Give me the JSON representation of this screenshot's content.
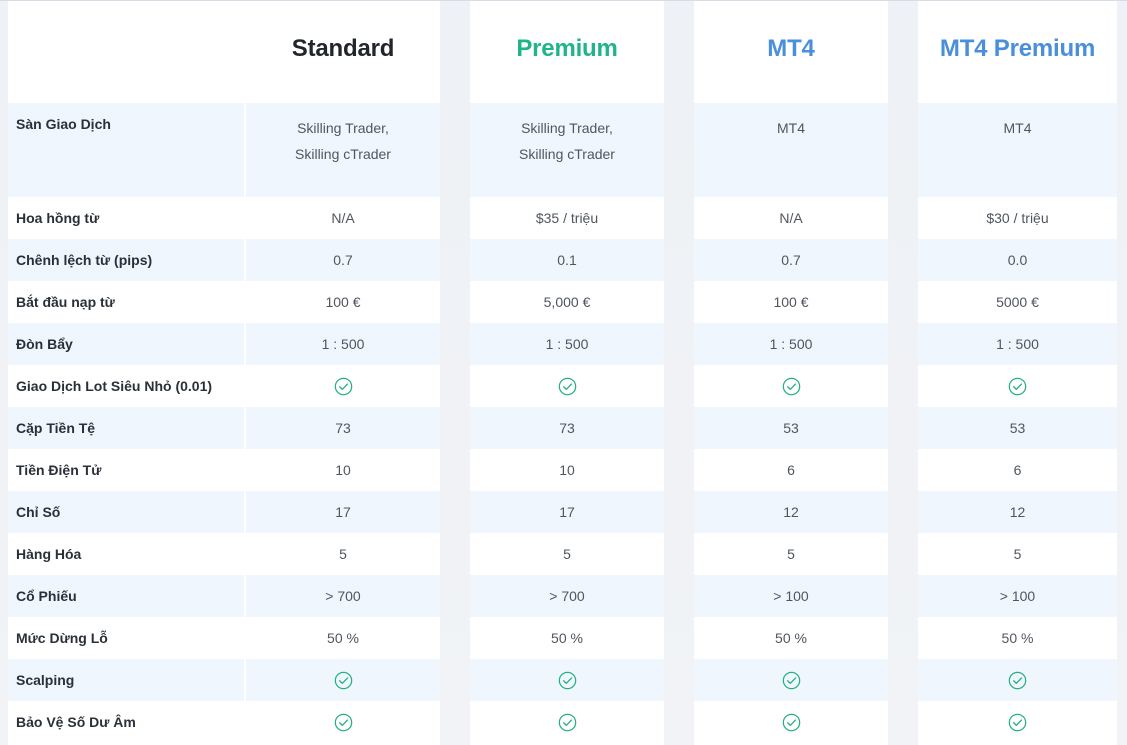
{
  "columns": [
    {
      "name": "Standard",
      "color": "#22262c"
    },
    {
      "name": "Premium",
      "color": "#1fb48c"
    },
    {
      "name": "MT4",
      "color": "#4a8fdc"
    },
    {
      "name": "MT4 Premium",
      "color": "#4a8fdc"
    }
  ],
  "check_color": "#27b07f",
  "rows": [
    {
      "label": "Sàn Giao Dịch",
      "values": [
        [
          "Skilling Trader,",
          "Skilling cTrader"
        ],
        [
          "Skilling Trader,",
          "Skilling cTrader"
        ],
        [
          "MT4"
        ],
        [
          "MT4"
        ]
      ]
    },
    {
      "label": "Hoa hồng từ",
      "values": [
        "N/A",
        "$35 / triệu",
        "N/A",
        "$30 / triệu"
      ]
    },
    {
      "label": "Chênh lệch từ (pips)",
      "values": [
        "0.7",
        "0.1",
        "0.7",
        "0.0"
      ]
    },
    {
      "label": "Bắt đầu nạp từ",
      "values": [
        "100 €",
        "5,000 €",
        "100 €",
        "5000 €"
      ]
    },
    {
      "label": "Đòn Bẩy",
      "values": [
        "1 : 500",
        "1 : 500",
        "1 : 500",
        "1 : 500"
      ]
    },
    {
      "label": "Giao Dịch Lot Siêu Nhỏ (0.01)",
      "values": [
        "check-icon",
        "check-icon",
        "check-icon",
        "check-icon"
      ]
    },
    {
      "label": "Cặp Tiền Tệ",
      "values": [
        "73",
        "73",
        "53",
        "53"
      ]
    },
    {
      "label": "Tiền Điện Tử",
      "values": [
        "10",
        "10",
        "6",
        "6"
      ]
    },
    {
      "label": "Chỉ Số",
      "values": [
        "17",
        "17",
        "12",
        "12"
      ]
    },
    {
      "label": "Hàng Hóa",
      "values": [
        "5",
        "5",
        "5",
        "5"
      ]
    },
    {
      "label": "Cổ Phiếu",
      "values": [
        "> 700",
        "> 700",
        "> 100",
        "> 100"
      ]
    },
    {
      "label": "Mức Dừng Lỗ",
      "values": [
        "50 %",
        "50 %",
        "50 %",
        "50 %"
      ]
    },
    {
      "label": "Scalping",
      "values": [
        "check-icon",
        "check-icon",
        "check-icon",
        "check-icon"
      ]
    },
    {
      "label": "Bảo Vệ Số Dư Âm",
      "values": [
        "check-icon",
        "check-icon",
        "check-icon",
        "check-icon"
      ]
    }
  ]
}
